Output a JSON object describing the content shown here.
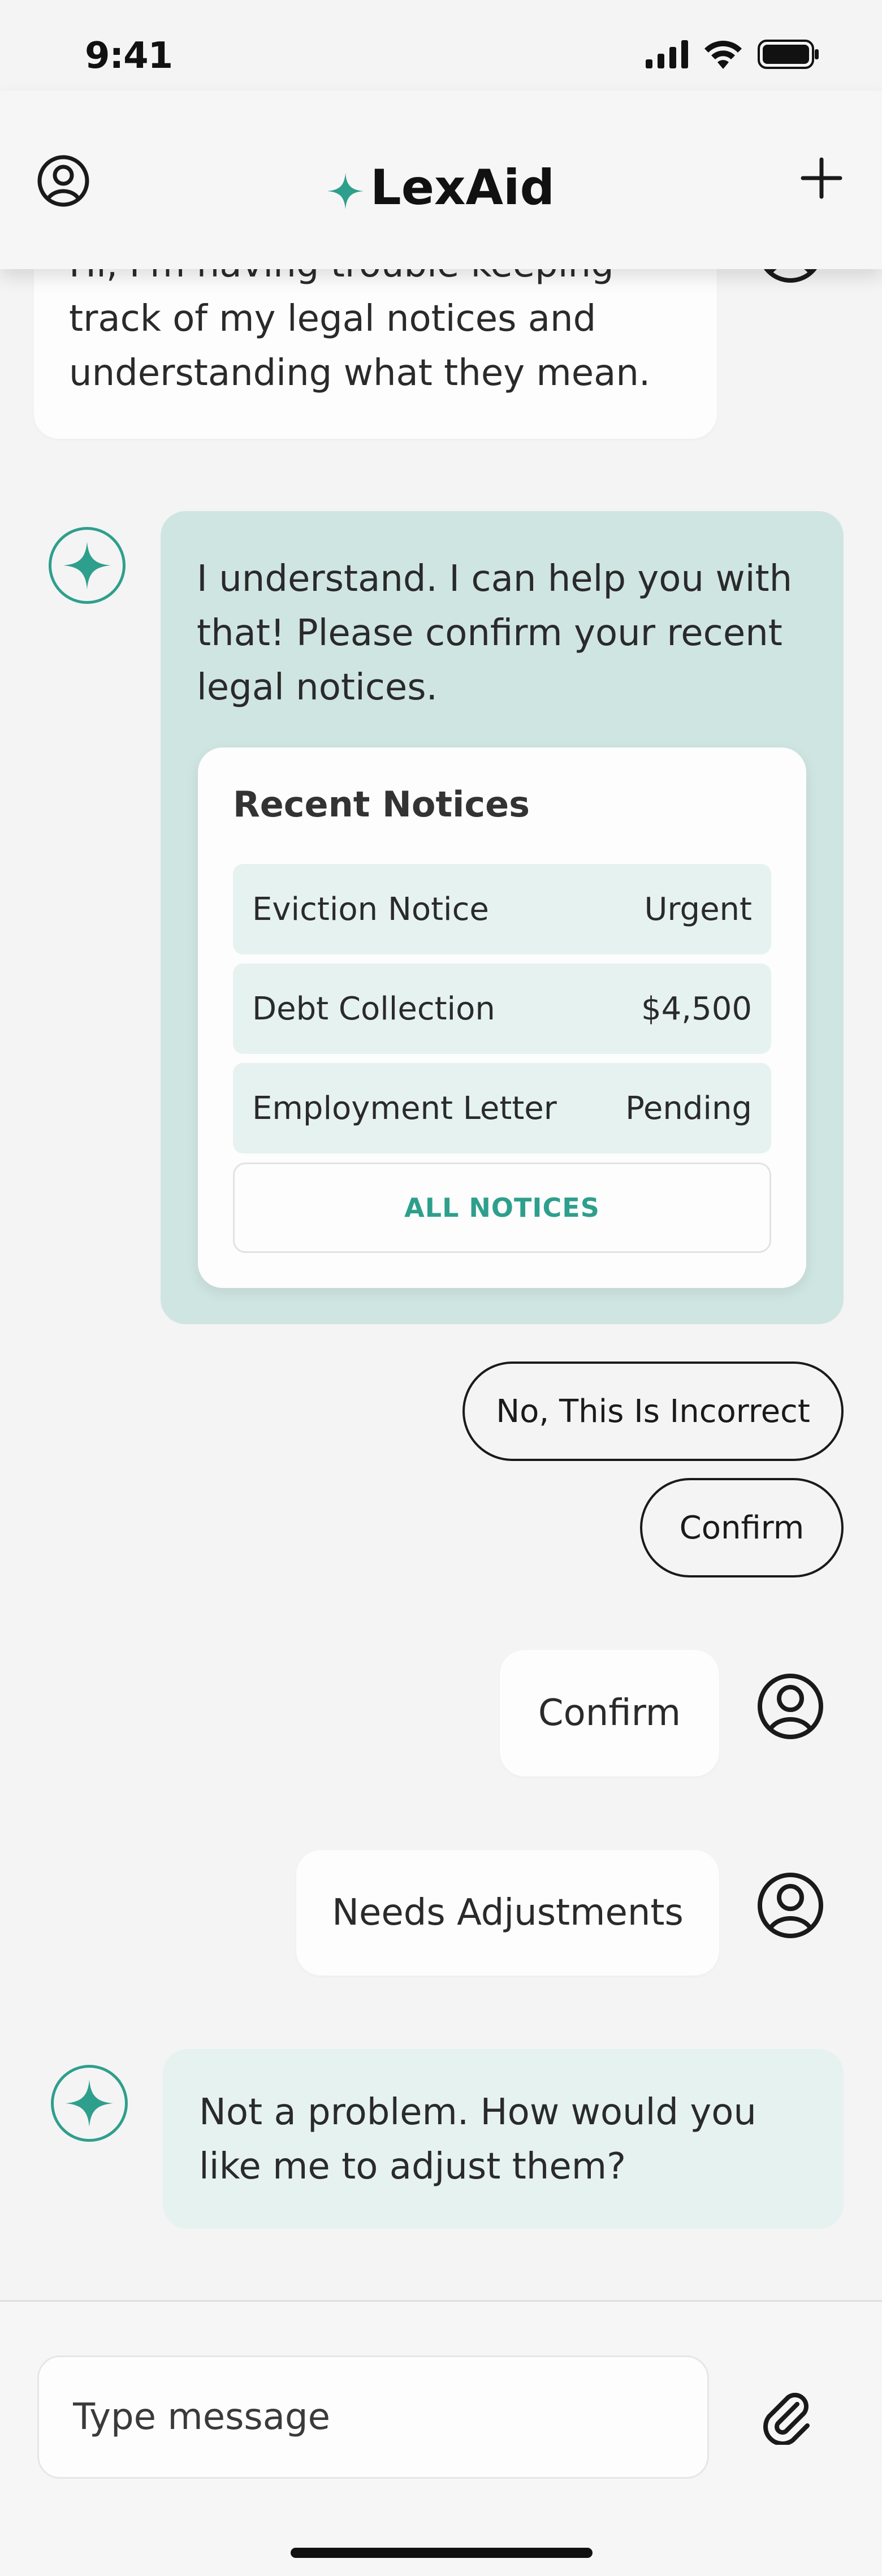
{
  "status_bar": {
    "time": "9:41"
  },
  "header": {
    "title": "LexAid"
  },
  "messages": {
    "user_intro": [
      "Hi, I'm having trouble keeping",
      "track of my legal notices and",
      "understanding what they mean."
    ],
    "bot_confirm": [
      "I understand. I can help you with",
      "that! Please confirm your recent",
      "legal notices."
    ],
    "card": {
      "title": "Recent Notices",
      "rows": [
        {
          "label": "Eviction Notice",
          "value": "Urgent"
        },
        {
          "label": "Debt Collection",
          "value": "$4,500"
        },
        {
          "label": "Employment Letter",
          "value": "Pending"
        }
      ],
      "all_button": "ALL NOTICES"
    },
    "quick_replies": {
      "incorrect": "No, This Is Incorrect",
      "confirm": "Confirm"
    },
    "user_confirm": "Confirm",
    "user_adjust": "Needs Adjustments",
    "bot_adjust": [
      "Not a problem. How would you",
      "like me to adjust them?"
    ]
  },
  "input": {
    "placeholder": "Type message"
  },
  "colors": {
    "accent": "#2e9f8c",
    "bot_bubble": "#cfe5e2",
    "bot_bubble_light": "#e6f2f0",
    "background": "#f4f4f4"
  }
}
